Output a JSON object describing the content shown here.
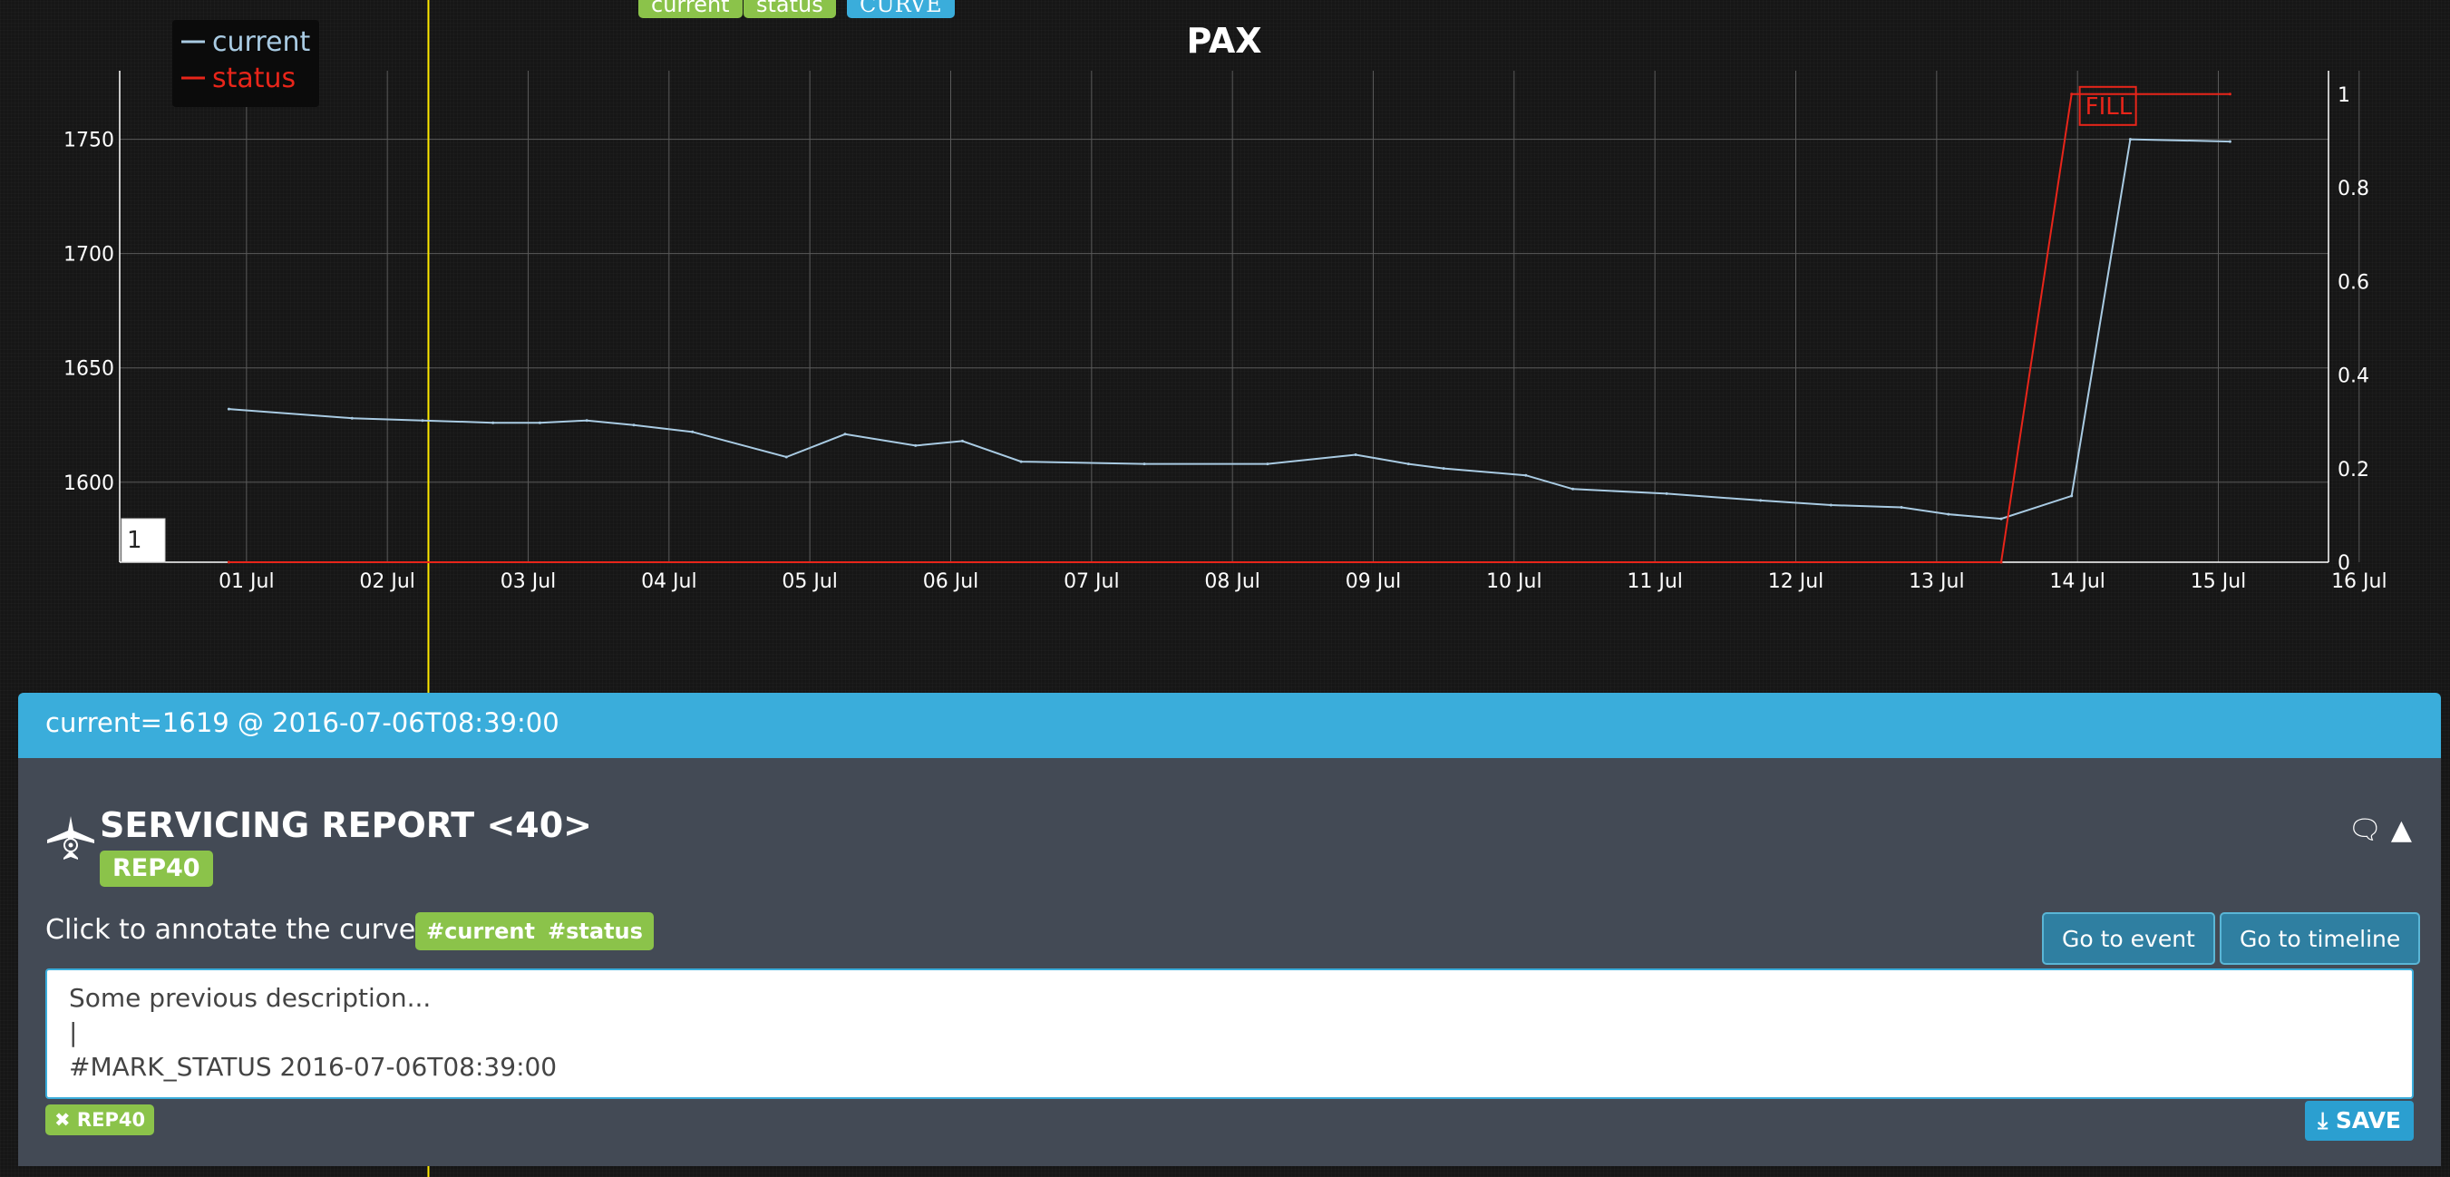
{
  "top_buttons": {
    "current": "current",
    "status": "status",
    "curve": "CURVE"
  },
  "page_input": {
    "value": "1"
  },
  "chart_data": {
    "type": "line",
    "title": "PAX",
    "legend": {
      "placement": "top-left",
      "entries": [
        "current",
        "status"
      ]
    },
    "x_tick_labels": [
      "01 Jul",
      "02 Jul",
      "03 Jul",
      "04 Jul",
      "05 Jul",
      "06 Jul",
      "07 Jul",
      "08 Jul",
      "09 Jul",
      "10 Jul",
      "11 Jul",
      "12 Jul",
      "13 Jul",
      "14 Jul",
      "15 Jul",
      "16 Jul"
    ],
    "xlim": [
      "2016-07-01T00:00",
      "2016-07-16T00:00"
    ],
    "y_left": {
      "ticks": [
        "1600",
        "1650",
        "1700",
        "1750"
      ],
      "ylim": [
        1565,
        1780
      ]
    },
    "y_right": {
      "ticks": [
        "0",
        "0.2",
        "0.4",
        "0.6",
        "0.8",
        "1"
      ],
      "ylim": [
        0,
        1.05
      ]
    },
    "grid": true,
    "cursor_x": "2016-07-02T13:00",
    "series": [
      {
        "name": "current",
        "color": "#a9cbe3",
        "axis": "left",
        "x": [
          "2016-07-01T03:00",
          "2016-07-02T00:00",
          "2016-07-02T12:00",
          "2016-07-03T00:00",
          "2016-07-03T08:00",
          "2016-07-03T16:00",
          "2016-07-04T00:00",
          "2016-07-04T10:00",
          "2016-07-05T02:00",
          "2016-07-05T12:00",
          "2016-07-06T00:00",
          "2016-07-06T08:00",
          "2016-07-06T18:00",
          "2016-07-07T15:00",
          "2016-07-08T12:00",
          "2016-07-09T03:00",
          "2016-07-09T12:00",
          "2016-07-09T18:00",
          "2016-07-10T08:00",
          "2016-07-10T16:00",
          "2016-07-11T08:00",
          "2016-07-12T00:00",
          "2016-07-12T12:00",
          "2016-07-13T00:00",
          "2016-07-13T08:00",
          "2016-07-13T17:00",
          "2016-07-14T05:00",
          "2016-07-14T15:00",
          "2016-07-15T08:00"
        ],
        "values": [
          1632,
          1628,
          1627,
          1626,
          1626,
          1627,
          1625,
          1622,
          1611,
          1621,
          1616,
          1618,
          1609,
          1608,
          1608,
          1612,
          1608,
          1606,
          1603,
          1597,
          1595,
          1592,
          1590,
          1589,
          1586,
          1584,
          1594,
          1750,
          1749
        ]
      },
      {
        "name": "status",
        "color": "#e8251a",
        "axis": "right",
        "x": [
          "2016-07-01T03:00",
          "2016-07-13T17:00",
          "2016-07-14T05:00",
          "2016-07-15T08:00"
        ],
        "values": [
          0,
          0,
          1,
          1
        ]
      }
    ],
    "annotations": [
      {
        "text": "FILL",
        "x": "2016-07-14T07:00",
        "y": 1
      }
    ]
  },
  "panel": {
    "header": "current=1619 @ 2016-07-06T08:39:00",
    "title": "SERVICING REPORT <40>",
    "badge": "REP40",
    "annotate_label": "Click to annotate the curve:",
    "annotate_tags": [
      "#current",
      "#status"
    ],
    "go_event": "Go to event",
    "go_timeline": "Go to timeline",
    "textarea_value": "Some previous description...\n|\n#MARK_STATUS 2016-07-06T08:39:00",
    "remove_tag": "REP40",
    "save": "SAVE"
  }
}
